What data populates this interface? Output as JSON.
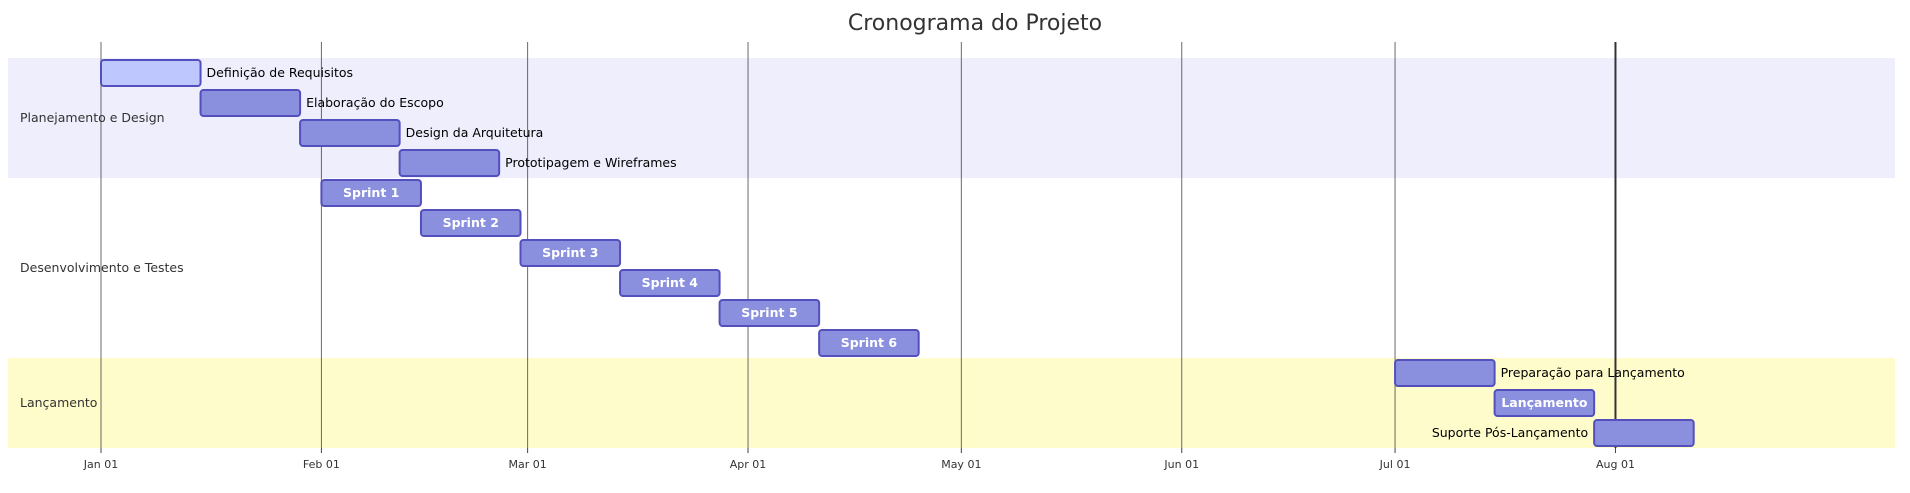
{
  "chart_data": {
    "type": "gantt",
    "title": "Cronograma do Projeto",
    "today_marker": "2024-08-01",
    "x_range": [
      "2024-01-01",
      "2024-09-02"
    ],
    "ticks": [
      {
        "date": "2024-01-01",
        "label": "Jan 01"
      },
      {
        "date": "2024-02-01",
        "label": "Feb 01"
      },
      {
        "date": "2024-03-01",
        "label": "Mar 01"
      },
      {
        "date": "2024-04-01",
        "label": "Apr 01"
      },
      {
        "date": "2024-05-01",
        "label": "May 01"
      },
      {
        "date": "2024-06-01",
        "label": "Jun 01"
      },
      {
        "date": "2024-07-01",
        "label": "Jul 01"
      },
      {
        "date": "2024-08-01",
        "label": "Aug 01"
      }
    ],
    "sections": [
      {
        "name": "Planejamento e Design",
        "color": "#eeeefd",
        "tasks": [
          {
            "name": "Definição de Requisitos",
            "start": "2024-01-01",
            "end": "2024-01-15",
            "status": "active",
            "label_position": "right"
          },
          {
            "name": "Elaboração do Escopo",
            "start": "2024-01-15",
            "end": "2024-01-29",
            "status": "normal",
            "label_position": "right"
          },
          {
            "name": "Design da Arquitetura",
            "start": "2024-01-29",
            "end": "2024-02-12",
            "status": "normal",
            "label_position": "right"
          },
          {
            "name": "Prototipagem e Wireframes",
            "start": "2024-02-12",
            "end": "2024-02-26",
            "status": "normal",
            "label_position": "right"
          }
        ]
      },
      {
        "name": "Desenvolvimento e Testes",
        "color": "#ffffff",
        "tasks": [
          {
            "name": "Sprint 1",
            "start": "2024-02-01",
            "end": "2024-02-15",
            "status": "normal",
            "label_position": "inside"
          },
          {
            "name": "Sprint 2",
            "start": "2024-02-15",
            "end": "2024-02-29",
            "status": "normal",
            "label_position": "inside"
          },
          {
            "name": "Sprint 3",
            "start": "2024-02-29",
            "end": "2024-03-14",
            "status": "normal",
            "label_position": "inside"
          },
          {
            "name": "Sprint 4",
            "start": "2024-03-14",
            "end": "2024-03-28",
            "status": "normal",
            "label_position": "inside"
          },
          {
            "name": "Sprint 5",
            "start": "2024-03-28",
            "end": "2024-04-11",
            "status": "normal",
            "label_position": "inside"
          },
          {
            "name": "Sprint 6",
            "start": "2024-04-11",
            "end": "2024-04-25",
            "status": "normal",
            "label_position": "inside"
          }
        ]
      },
      {
        "name": "Lançamento",
        "color": "#fffccb",
        "tasks": [
          {
            "name": "Preparação para Lançamento",
            "start": "2024-07-01",
            "end": "2024-07-15",
            "status": "normal",
            "label_position": "right"
          },
          {
            "name": "Lançamento",
            "start": "2024-07-15",
            "end": "2024-07-29",
            "status": "normal",
            "label_position": "inside"
          },
          {
            "name": "Suporte Pós-Lançamento",
            "start": "2024-07-29",
            "end": "2024-08-12",
            "status": "normal",
            "label_position": "left"
          }
        ]
      }
    ],
    "colors": {
      "bar_fill": "#8a90dd",
      "bar_active_fill": "#bfc7ff",
      "bar_stroke": "#534fbc",
      "grid_line": "#444444",
      "today_line": "#333333"
    }
  }
}
